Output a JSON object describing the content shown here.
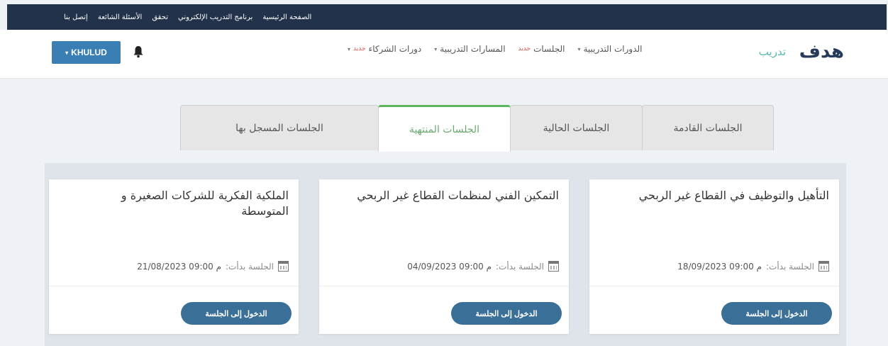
{
  "topbar": {
    "links": [
      "الصفحة الرئيسية",
      "برنامج التدريب الإلكتروني",
      "تحقق",
      "الأسئلة الشائعة",
      "إتصل بنا"
    ]
  },
  "header": {
    "user_label": "KHULUD",
    "logo_mark": "هدف",
    "logo_sub": "تدريب",
    "nav": [
      {
        "label": "الدورات التدريبية",
        "caret": "▾"
      },
      {
        "label": "الجلسات",
        "badge": "جديد"
      },
      {
        "label": "المسارات التدريبية",
        "caret": "▾"
      },
      {
        "label": "دورات الشركاء",
        "badge": "جديد",
        "caret": "▾"
      }
    ]
  },
  "tabs": [
    "الجلسات القادمة",
    "الجلسات الحالية",
    "الجلسات المنتهية",
    "الجلسات المسجل بها"
  ],
  "active_tab": "الجلسات المنتهية",
  "cards": [
    {
      "title": "التأهيل والتوظيف في القطاع غير الربحي",
      "meta_label": "الجلسة بدأت:",
      "date": "18/09/2023 09:00 م",
      "button": "الدخول إلى الجلسة"
    },
    {
      "title": "التمكين الفني لمنظمات القطاع غير الربحي",
      "meta_label": "الجلسة بدأت:",
      "date": "04/09/2023 09:00 م",
      "button": "الدخول إلى الجلسة"
    },
    {
      "title": "الملكية الفكرية للشركات الصغيرة و المتوسطة",
      "meta_label": "الجلسة بدأت:",
      "date": "21/08/2023 09:00 م",
      "button": "الدخول إلى الجلسة"
    }
  ],
  "colors": {
    "topbar": "#22324a",
    "accent": "#3a7fb3",
    "button": "#3a6f97",
    "active_tab": "#5cb85c"
  }
}
